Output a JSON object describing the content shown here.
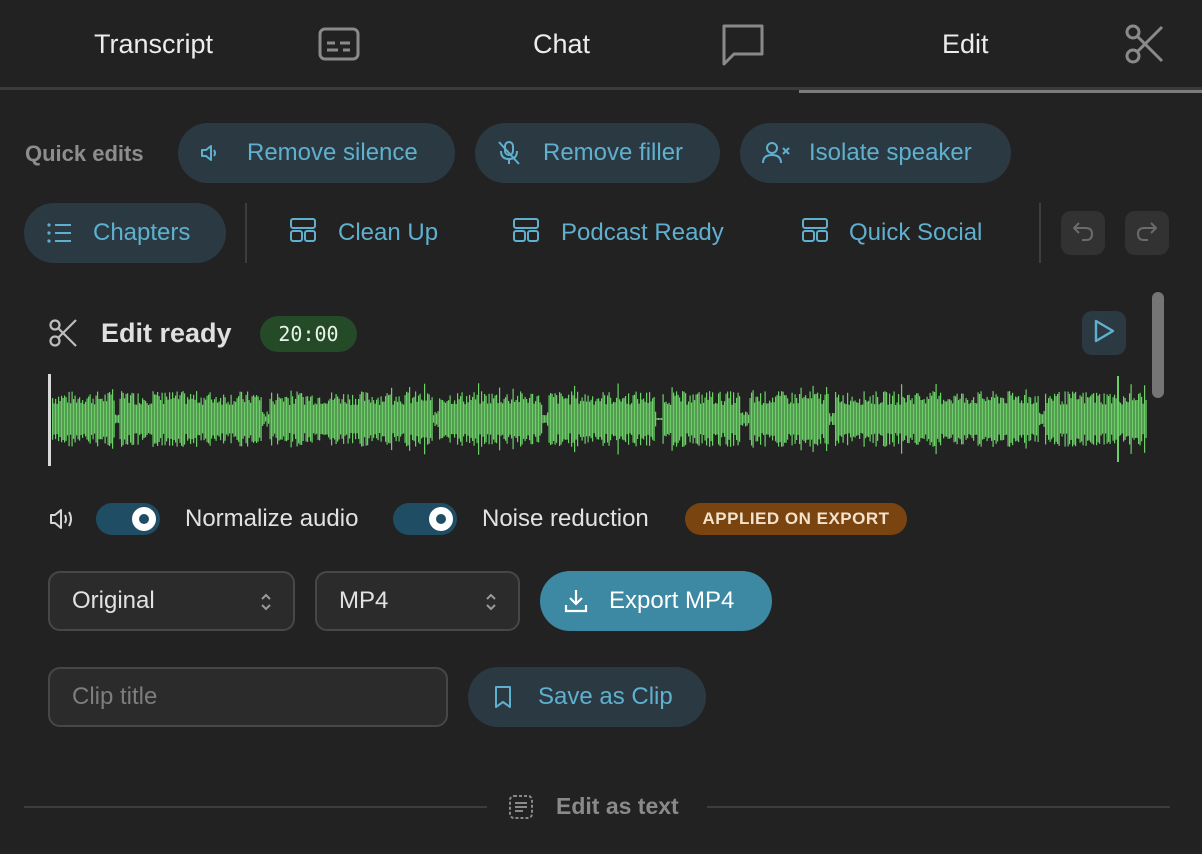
{
  "tabs": [
    {
      "label": "Transcript",
      "icon": "captions-icon"
    },
    {
      "label": "Chat",
      "icon": "chat-bubble-icon"
    },
    {
      "label": "Edit",
      "icon": "scissors-icon",
      "active": true
    }
  ],
  "quick_edits": {
    "label": "Quick edits",
    "actions": [
      {
        "label": "Remove silence",
        "icon": "speaker-icon"
      },
      {
        "label": "Remove filler",
        "icon": "mic-off-icon"
      },
      {
        "label": "Isolate speaker",
        "icon": "user-x-icon"
      }
    ]
  },
  "templates": {
    "chapters_label": "Chapters",
    "items": [
      {
        "label": "Clean Up",
        "icon": "layout-template-icon"
      },
      {
        "label": "Podcast Ready",
        "icon": "layout-template-icon"
      },
      {
        "label": "Quick Social",
        "icon": "layout-template-icon"
      }
    ]
  },
  "edit": {
    "title": "Edit ready",
    "duration": "20:00",
    "waveform_color": "#6bd068"
  },
  "audio": {
    "normalize_label": "Normalize audio",
    "normalize_on": true,
    "noise_label": "Noise reduction",
    "noise_on": true,
    "applied_badge": "APPLIED ON EXPORT"
  },
  "export": {
    "resolution": "Original",
    "format": "MP4",
    "button_label": "Export MP4"
  },
  "clip": {
    "placeholder": "Clip title",
    "save_label": "Save as Clip"
  },
  "footer": {
    "edit_as_text": "Edit as text"
  },
  "colors": {
    "accent": "#5fb0cf",
    "export_button": "#3d88a2",
    "badge_time": "#244a27",
    "badge_applied": "#7a4410"
  }
}
